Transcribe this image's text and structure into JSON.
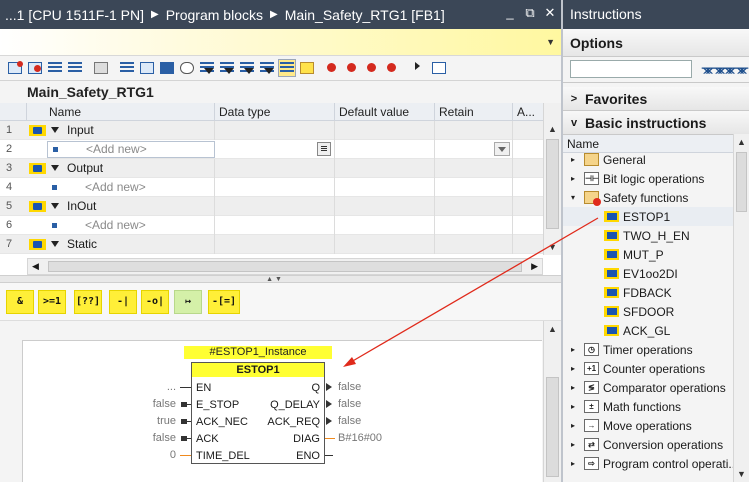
{
  "editor": {
    "breadcrumb": [
      "...1 [CPU 1511F-1 PN]",
      "Program blocks",
      "Main_Safety_RTG1 [FB1]"
    ],
    "window_buttons": [
      "_",
      "⧉",
      "✕"
    ],
    "block_name": "Main_Safety_RTG1"
  },
  "interface": {
    "columns": [
      "Name",
      "Data type",
      "Default value",
      "Retain",
      "A..."
    ],
    "rows": [
      {
        "num": "1",
        "name": "Input",
        "kind": "section"
      },
      {
        "num": "2",
        "name": "<Add new>",
        "kind": "add",
        "editing": true
      },
      {
        "num": "3",
        "name": "Output",
        "kind": "section"
      },
      {
        "num": "4",
        "name": "<Add new>",
        "kind": "add"
      },
      {
        "num": "5",
        "name": "InOut",
        "kind": "section"
      },
      {
        "num": "6",
        "name": "<Add new>",
        "kind": "add"
      },
      {
        "num": "7",
        "name": "Static",
        "kind": "section"
      }
    ]
  },
  "fbd_toolbar": {
    "buttons": [
      "&",
      ">=1",
      "[??]",
      "-|",
      "-o|",
      "↦",
      "-[=]"
    ]
  },
  "fbd": {
    "instance_name": "#ESTOP1_Instance",
    "block_type": "ESTOP1",
    "inputs": [
      {
        "pin": "EN",
        "value": "..."
      },
      {
        "pin": "E_STOP",
        "value": "false"
      },
      {
        "pin": "ACK_NEC",
        "value": "true"
      },
      {
        "pin": "ACK",
        "value": "false"
      },
      {
        "pin": "TIME_DEL",
        "value": "0"
      }
    ],
    "outputs": [
      {
        "pin": "Q",
        "value": "false"
      },
      {
        "pin": "Q_DELAY",
        "value": "false"
      },
      {
        "pin": "ACK_REQ",
        "value": "false"
      },
      {
        "pin": "DIAG",
        "value": "B#16#00"
      },
      {
        "pin": "ENO",
        "value": ""
      }
    ]
  },
  "instructions_panel": {
    "title": "Instructions",
    "options_label": "Options",
    "favorites_label": "Favorites",
    "basic_label": "Basic instructions",
    "column_name": "Name",
    "tree": [
      {
        "label": "General",
        "icon": "folder-icon",
        "expand": "▸",
        "indent": 0
      },
      {
        "label": "Bit logic operations",
        "icon": "bit-logic-icon",
        "expand": "▸",
        "indent": 0
      },
      {
        "label": "Safety functions",
        "icon": "safety-folder-icon",
        "expand": "▾",
        "indent": 0
      },
      {
        "label": "ESTOP1",
        "icon": "function-block-icon",
        "expand": "",
        "indent": 1,
        "selected": true
      },
      {
        "label": "TWO_H_EN",
        "icon": "function-block-icon",
        "expand": "",
        "indent": 1
      },
      {
        "label": "MUT_P",
        "icon": "function-block-icon",
        "expand": "",
        "indent": 1
      },
      {
        "label": "EV1oo2DI",
        "icon": "function-block-icon",
        "expand": "",
        "indent": 1
      },
      {
        "label": "FDBACK",
        "icon": "function-block-icon",
        "expand": "",
        "indent": 1
      },
      {
        "label": "SFDOOR",
        "icon": "function-block-icon",
        "expand": "",
        "indent": 1
      },
      {
        "label": "ACK_GL",
        "icon": "function-block-icon",
        "expand": "",
        "indent": 1
      },
      {
        "label": "Timer operations",
        "icon": "timer-icon",
        "expand": "▸",
        "indent": 0
      },
      {
        "label": "Counter operations",
        "icon": "counter-icon",
        "expand": "▸",
        "indent": 0
      },
      {
        "label": "Comparator operations",
        "icon": "comparator-icon",
        "expand": "▸",
        "indent": 0
      },
      {
        "label": "Math functions",
        "icon": "math-icon",
        "expand": "▸",
        "indent": 0
      },
      {
        "label": "Move operations",
        "icon": "move-icon",
        "expand": "▸",
        "indent": 0
      },
      {
        "label": "Conversion operations",
        "icon": "conversion-icon",
        "expand": "▸",
        "indent": 0
      },
      {
        "label": "Program control operati...",
        "icon": "program-control-icon",
        "expand": "▸",
        "indent": 0
      }
    ]
  },
  "colors": {
    "titlebar": "#3b4757",
    "highlight_yellow": "#ffff33",
    "fb_icon_blue": "#1a55b0",
    "arrow_red": "#e02a1b"
  }
}
